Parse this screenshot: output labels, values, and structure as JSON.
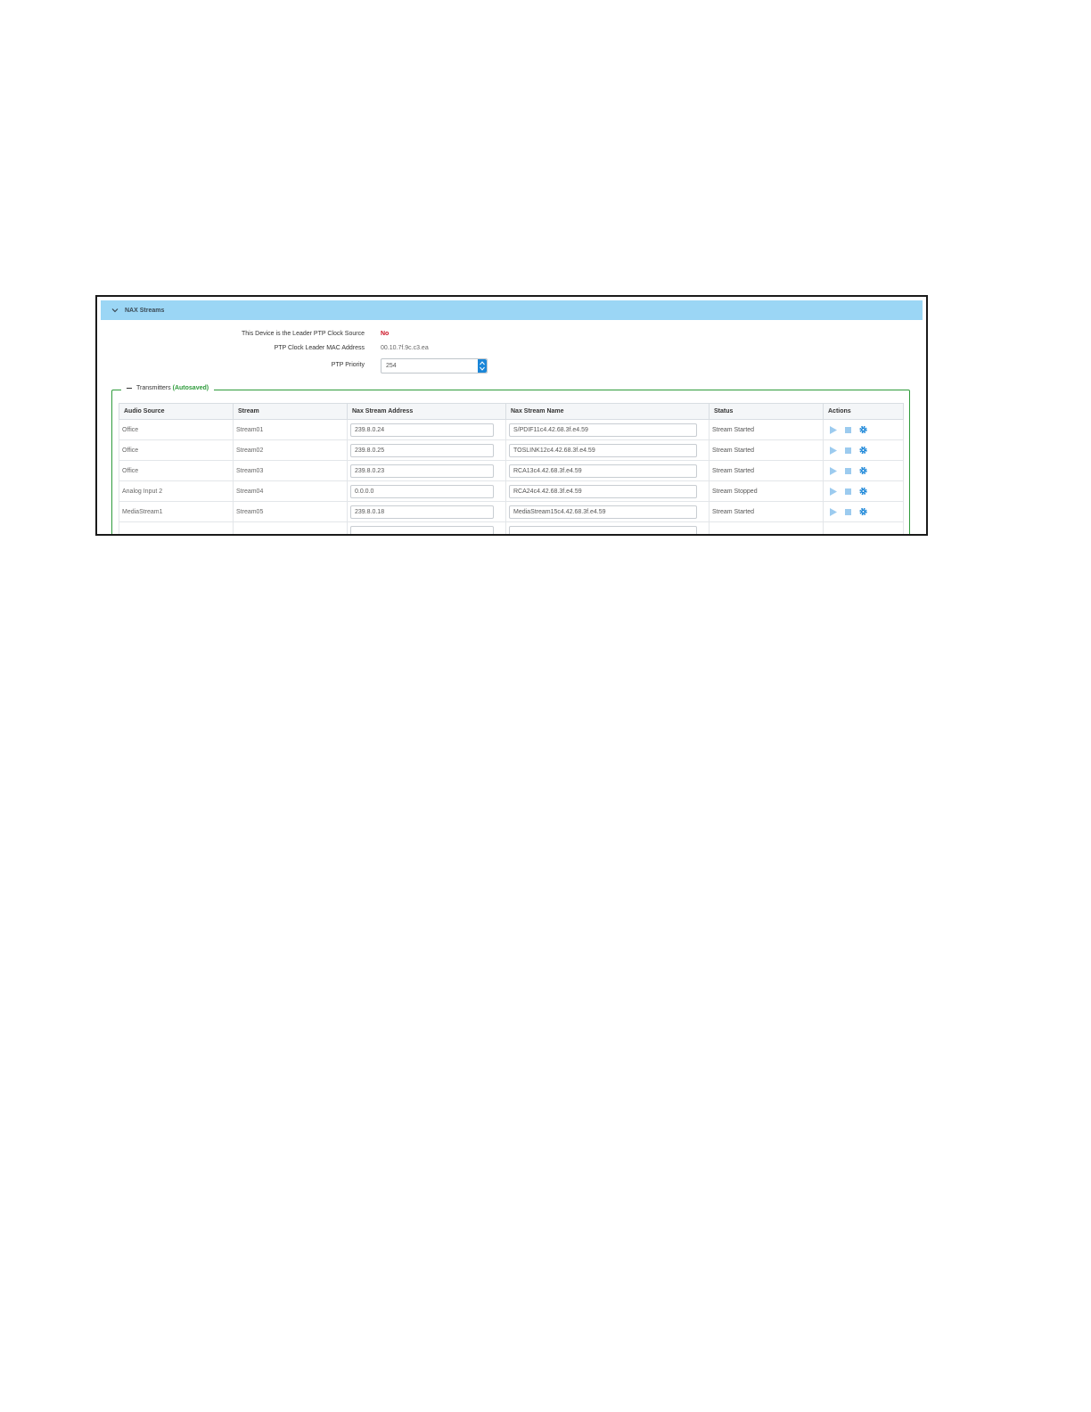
{
  "panel": {
    "title": "NAX Streams"
  },
  "ptp": {
    "leader_label": "This Device is the Leader PTP Clock Source",
    "leader_value": "No",
    "mac_label": "PTP Clock Leader MAC Address",
    "mac_value": "00.10.7f.9c.c3.ea",
    "priority_label": "PTP Priority",
    "priority_value": "254"
  },
  "transmitters": {
    "legend_label": "Transmitters",
    "legend_status": "(Autosaved)",
    "columns": [
      "Audio Source",
      "Stream",
      "Nax Stream Address",
      "Nax Stream Name",
      "Status",
      "Actions"
    ],
    "rows": [
      {
        "audio_source": "Office",
        "stream": "Stream01",
        "address": "239.8.0.24",
        "name": "S/PDIF11c4.42.68.3f.e4.59",
        "status": "Stream Started"
      },
      {
        "audio_source": "Office",
        "stream": "Stream02",
        "address": "239.8.0.25",
        "name": "TOSLINK12c4.42.68.3f.e4.59",
        "status": "Stream Started"
      },
      {
        "audio_source": "Office",
        "stream": "Stream03",
        "address": "239.8.0.23",
        "name": "RCA13c4.42.68.3f.e4.59",
        "status": "Stream Started"
      },
      {
        "audio_source": "Analog Input 2",
        "stream": "Stream04",
        "address": "0.0.0.0",
        "name": "RCA24c4.42.68.3f.e4.59",
        "status": "Stream Stopped"
      },
      {
        "audio_source": "MediaStream1",
        "stream": "Stream05",
        "address": "239.8.0.18",
        "name": "MediaStream15c4.42.68.3f.e4.59",
        "status": "Stream Started"
      }
    ]
  },
  "colors": {
    "header_bg": "#9bd6f5",
    "accent_blue": "#1a86d8",
    "play_light_blue": "#9ccbef",
    "alert_red": "#cc1122",
    "autosaved_green": "#2e9b3b"
  },
  "icons": {
    "collapse": "chevron-down-icon",
    "spinner": "spinner-arrows-icon",
    "play": "play-icon",
    "stop": "stop-icon",
    "settings": "gear-icon"
  }
}
